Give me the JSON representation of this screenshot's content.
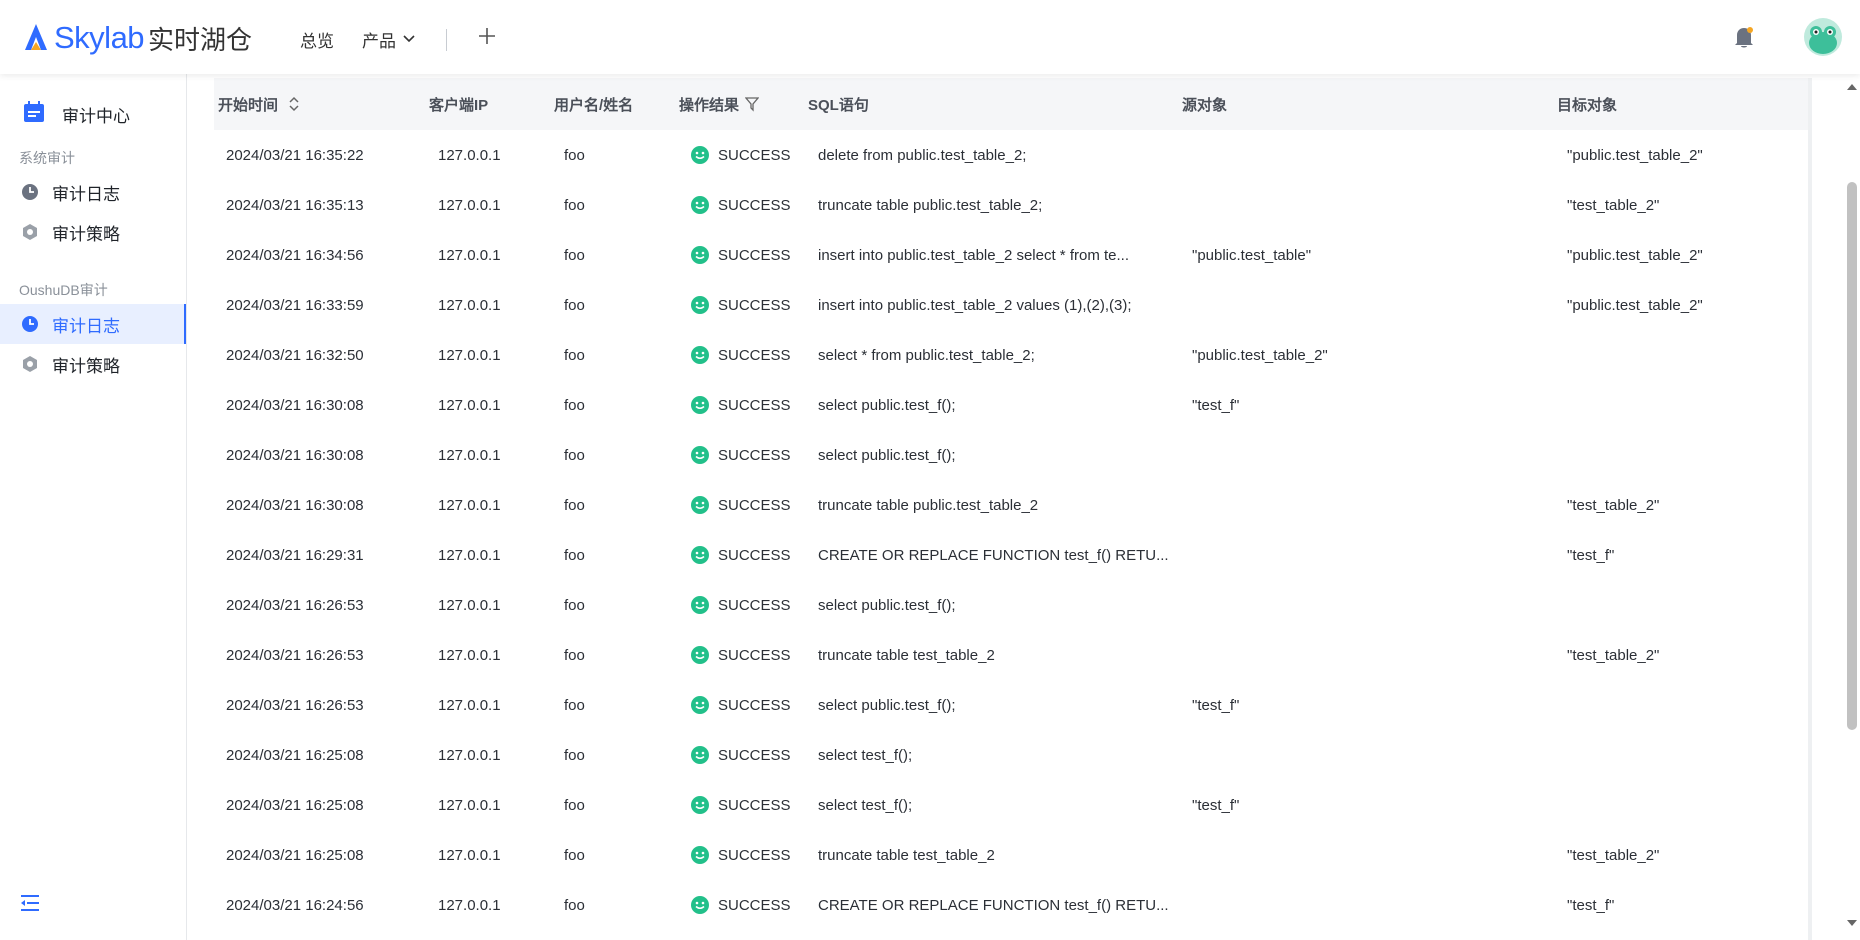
{
  "header": {
    "brand": "Skylab",
    "brand_cn": "实时湖仓",
    "nav_overview": "总览",
    "nav_products": "产品"
  },
  "sidebar": {
    "title": "审计中心",
    "group_system": "系统审计",
    "system_items": [
      {
        "label": "审计日志"
      },
      {
        "label": "审计策略"
      }
    ],
    "group_oushu": "OushuDB审计",
    "oushu_items": [
      {
        "label": "审计日志",
        "active": true
      },
      {
        "label": "审计策略"
      }
    ]
  },
  "table": {
    "columns": {
      "start_time": "开始时间",
      "client_ip": "客户端IP",
      "user": "用户名/姓名",
      "result": "操作结果",
      "sql": "SQL语句",
      "source": "源对象",
      "target": "目标对象"
    },
    "rows": [
      {
        "time": "2024/03/21 16:35:22",
        "ip": "127.0.0.1",
        "user": "foo",
        "result": "SUCCESS",
        "sql": "delete from public.test_table_2;",
        "source": "",
        "target": "\"public.test_table_2\""
      },
      {
        "time": "2024/03/21 16:35:13",
        "ip": "127.0.0.1",
        "user": "foo",
        "result": "SUCCESS",
        "sql": "truncate table public.test_table_2;",
        "source": "",
        "target": "\"test_table_2\""
      },
      {
        "time": "2024/03/21 16:34:56",
        "ip": "127.0.0.1",
        "user": "foo",
        "result": "SUCCESS",
        "sql": "insert into public.test_table_2 select * from te...",
        "source": "\"public.test_table\"",
        "target": "\"public.test_table_2\""
      },
      {
        "time": "2024/03/21 16:33:59",
        "ip": "127.0.0.1",
        "user": "foo",
        "result": "SUCCESS",
        "sql": "insert into public.test_table_2 values (1),(2),(3);",
        "source": "",
        "target": "\"public.test_table_2\""
      },
      {
        "time": "2024/03/21 16:32:50",
        "ip": "127.0.0.1",
        "user": "foo",
        "result": "SUCCESS",
        "sql": "select * from public.test_table_2;",
        "source": "\"public.test_table_2\"",
        "target": ""
      },
      {
        "time": "2024/03/21 16:30:08",
        "ip": "127.0.0.1",
        "user": "foo",
        "result": "SUCCESS",
        "sql": "select public.test_f();",
        "source": "\"test_f\"",
        "target": ""
      },
      {
        "time": "2024/03/21 16:30:08",
        "ip": "127.0.0.1",
        "user": "foo",
        "result": "SUCCESS",
        "sql": "select public.test_f();",
        "source": "",
        "target": ""
      },
      {
        "time": "2024/03/21 16:30:08",
        "ip": "127.0.0.1",
        "user": "foo",
        "result": "SUCCESS",
        "sql": "truncate table public.test_table_2",
        "source": "",
        "target": "\"test_table_2\""
      },
      {
        "time": "2024/03/21 16:29:31",
        "ip": "127.0.0.1",
        "user": "foo",
        "result": "SUCCESS",
        "sql": "CREATE OR REPLACE FUNCTION test_f() RETU...",
        "source": "",
        "target": "\"test_f\""
      },
      {
        "time": "2024/03/21 16:26:53",
        "ip": "127.0.0.1",
        "user": "foo",
        "result": "SUCCESS",
        "sql": "select public.test_f();",
        "source": "",
        "target": ""
      },
      {
        "time": "2024/03/21 16:26:53",
        "ip": "127.0.0.1",
        "user": "foo",
        "result": "SUCCESS",
        "sql": "truncate table test_table_2",
        "source": "",
        "target": "\"test_table_2\""
      },
      {
        "time": "2024/03/21 16:26:53",
        "ip": "127.0.0.1",
        "user": "foo",
        "result": "SUCCESS",
        "sql": "select public.test_f();",
        "source": "\"test_f\"",
        "target": ""
      },
      {
        "time": "2024/03/21 16:25:08",
        "ip": "127.0.0.1",
        "user": "foo",
        "result": "SUCCESS",
        "sql": "select test_f();",
        "source": "",
        "target": ""
      },
      {
        "time": "2024/03/21 16:25:08",
        "ip": "127.0.0.1",
        "user": "foo",
        "result": "SUCCESS",
        "sql": "select test_f();",
        "source": "\"test_f\"",
        "target": ""
      },
      {
        "time": "2024/03/21 16:25:08",
        "ip": "127.0.0.1",
        "user": "foo",
        "result": "SUCCESS",
        "sql": "truncate table test_table_2",
        "source": "",
        "target": "\"test_table_2\""
      },
      {
        "time": "2024/03/21 16:24:56",
        "ip": "127.0.0.1",
        "user": "foo",
        "result": "SUCCESS",
        "sql": "CREATE OR REPLACE FUNCTION test_f() RETU...",
        "source": "",
        "target": "\"test_f\""
      }
    ]
  },
  "colors": {
    "accent": "#2f6bff",
    "success": "#22c08a"
  }
}
